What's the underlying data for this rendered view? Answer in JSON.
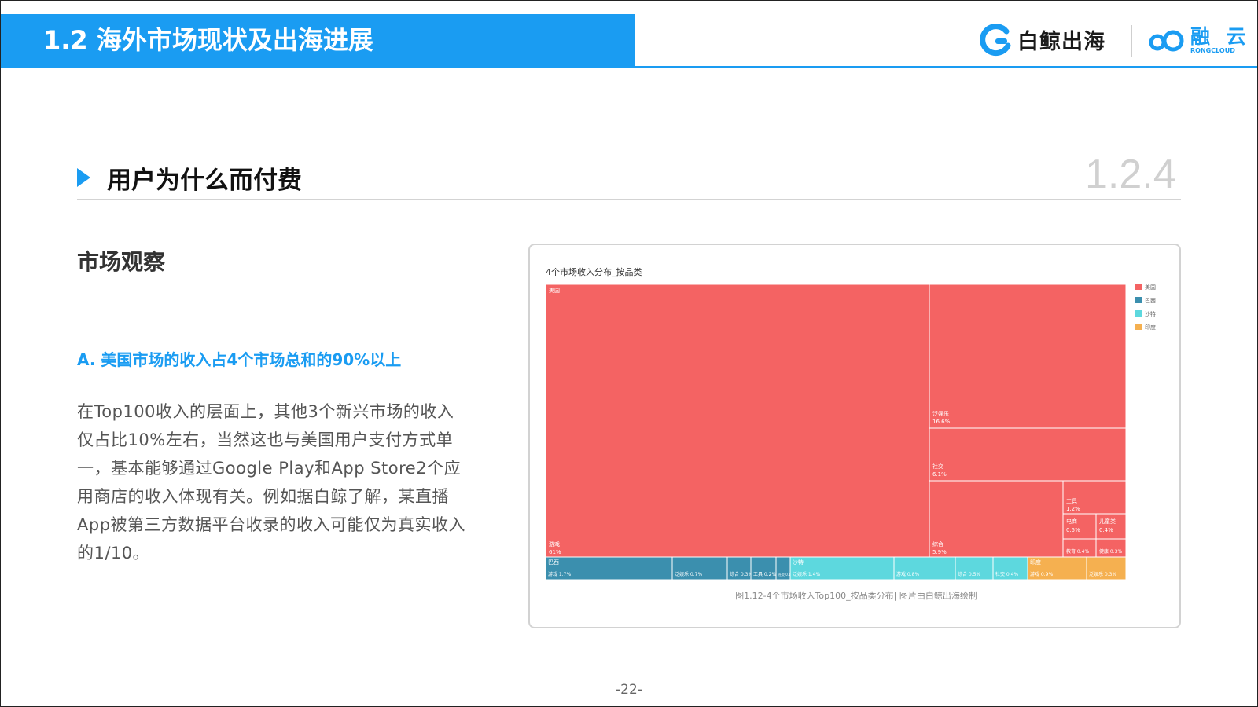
{
  "header": {
    "title": "1.2 海外市场现状及出海进展",
    "brand1": "白鲸出海",
    "brand2_main": "融 云",
    "brand2_sub": "RONGCLOUD"
  },
  "section": {
    "title": "用户为什么而付费",
    "number": "1.2.4"
  },
  "content": {
    "heading": "市场观察",
    "subheading": "A. 美国市场的收入占4个市场总和的90%以上",
    "paragraph": "在Top100收入的层面上，其他3个新兴市场的收入仅占比10%左右，当然这也与美国用户支付方式单一，基本能够通过Google Play和App Store2个应用商店的收入体现有关。例如据白鲸了解，某直播App被第三方数据平台收录的收入可能仅为真实收入的1/10。"
  },
  "page_number": "-22-",
  "colors": {
    "accent": "#1a9cf2",
    "us": "#f46363",
    "brazil": "#3b8fae",
    "saudi": "#5dd8de",
    "india": "#f5b050"
  },
  "chart_data": {
    "type": "treemap",
    "title": "4个市场收入分布_按品类",
    "caption": "图1.12-4个市场收入Top100_按品类分布| 图片由白鲸出海绘制",
    "legend": [
      "美国",
      "巴西",
      "沙特",
      "印度"
    ],
    "legend_position": "right",
    "markets": [
      {
        "name": "美国",
        "children": [
          {
            "name": "游戏",
            "value": 61
          },
          {
            "name": "泛娱乐",
            "value": 16.6
          },
          {
            "name": "社交",
            "value": 6.1
          },
          {
            "name": "综合",
            "value": 5.9
          },
          {
            "name": "工具",
            "value": 1.2
          },
          {
            "name": "电商",
            "value": 0.5
          },
          {
            "name": "儿童类",
            "value": 0.4
          },
          {
            "name": "教育",
            "value": 0.4
          },
          {
            "name": "健康",
            "value": 0.3
          }
        ]
      },
      {
        "name": "巴西",
        "children": [
          {
            "name": "游戏",
            "value": 1.7
          },
          {
            "name": "泛娱乐",
            "value": 0.7
          },
          {
            "name": "综合",
            "value": 0.3
          },
          {
            "name": "工具",
            "value": 0.2
          },
          {
            "name": "社交",
            "value": 0.1
          }
        ]
      },
      {
        "name": "沙特",
        "children": [
          {
            "name": "泛娱乐",
            "value": 1.4
          },
          {
            "name": "游戏",
            "value": 0.8
          },
          {
            "name": "综合",
            "value": 0.5
          },
          {
            "name": "社交",
            "value": 0.4
          }
        ]
      },
      {
        "name": "印度",
        "children": [
          {
            "name": "游戏",
            "value": 0.9
          },
          {
            "name": "泛娱乐",
            "value": 0.3
          }
        ]
      }
    ],
    "data_labels": [
      {
        "market": "美国",
        "name": "游戏",
        "text": "61%"
      },
      {
        "market": "美国",
        "name": "泛娱乐",
        "text": "16.6%"
      },
      {
        "market": "美国",
        "name": "社交",
        "text": "6.1%"
      },
      {
        "market": "美国",
        "name": "综合",
        "text": "5.9%"
      },
      {
        "market": "美国",
        "name": "工具",
        "text": "1.2%"
      },
      {
        "market": "美国",
        "name": "电商",
        "text": "0.5%"
      },
      {
        "market": "美国",
        "name": "儿童类",
        "text": "0.4%"
      },
      {
        "market": "美国",
        "name": "教育",
        "text": "0.4%"
      },
      {
        "market": "美国",
        "name": "健康",
        "text": "0.3%"
      },
      {
        "market": "巴西",
        "name": "游戏",
        "text": "1.7%"
      },
      {
        "market": "巴西",
        "name": "泛娱乐",
        "text": "0.7%"
      },
      {
        "market": "巴西",
        "name": "综合",
        "text": "0.3%"
      },
      {
        "market": "巴西",
        "name": "工具",
        "text": "0.2%"
      },
      {
        "market": "巴西",
        "name": "社交",
        "text": "0.1%"
      },
      {
        "market": "沙特",
        "name": "泛娱乐",
        "text": "1.4%"
      },
      {
        "market": "沙特",
        "name": "游戏",
        "text": "0.8%"
      },
      {
        "market": "沙特",
        "name": "综合",
        "text": "0.5%"
      },
      {
        "market": "沙特",
        "name": "社交",
        "text": "0.4%"
      },
      {
        "market": "印度",
        "name": "游戏",
        "text": "0.9%"
      },
      {
        "market": "印度",
        "name": "泛娱乐",
        "text": "0.3%"
      }
    ]
  }
}
